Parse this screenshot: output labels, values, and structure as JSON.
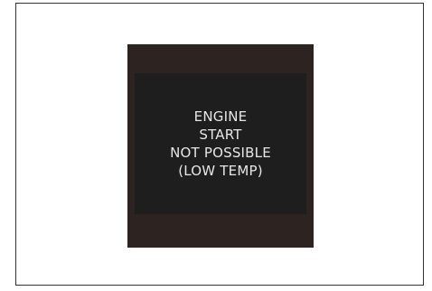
{
  "warning_message": {
    "lines": [
      "ENGINE",
      "START",
      "NOT POSSIBLE",
      "(LOW TEMP)"
    ]
  },
  "colors": {
    "bezel": "#2d2421",
    "screen": "#1e1e1e",
    "text": "#e6e6e6",
    "frame_border": "#333333"
  }
}
